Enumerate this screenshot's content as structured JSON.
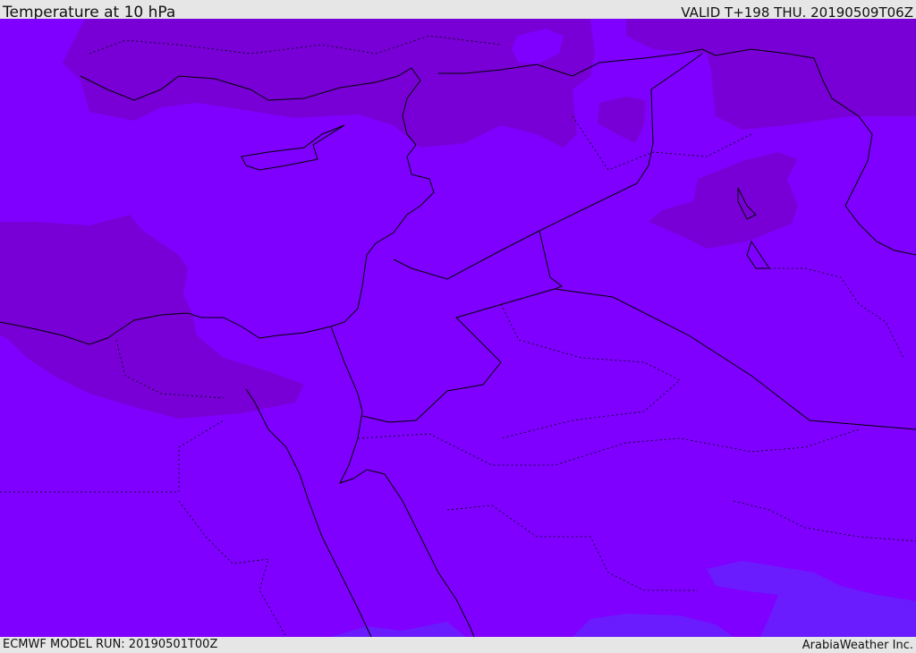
{
  "header": {
    "title": "Temperature at 10 hPa",
    "valid": "VALID T+198 THU. 20190509T06Z"
  },
  "footer": {
    "model_run": "ECMWF MODEL RUN: 20190501T00Z",
    "credit": "ArabiaWeather Inc."
  },
  "colors": {
    "base": "#7f00ff",
    "cooler": "#7800d6",
    "warmer": "#6a1cff",
    "border": "#000000",
    "frame": "#e6e6e6"
  }
}
